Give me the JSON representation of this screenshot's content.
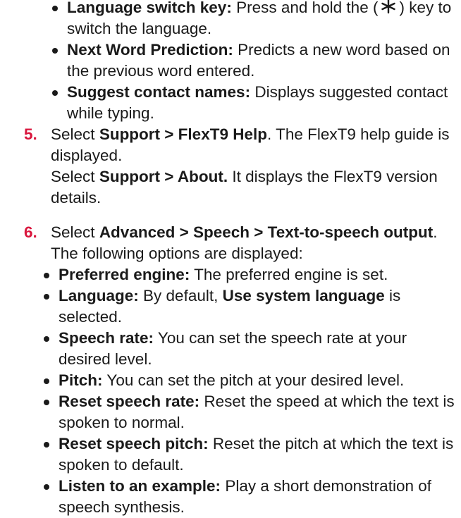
{
  "step4": {
    "lead_partial": "",
    "bullets": [
      {
        "term": "Language switch key:",
        "text_a": "Press and hold the (",
        "text_b": ") key to switch the language."
      },
      {
        "term": "Next Word Prediction:",
        "text": "Predicts a new word based on the previous word entered."
      },
      {
        "term": "Suggest contact names:",
        "text": "Displays suggested contact while typing."
      }
    ]
  },
  "step5": {
    "number": "5.",
    "pre1": "Select",
    "menu1": "Support > FlexT9 Help",
    "post1": ". The FlexT9 help guide is displayed.",
    "pre2": "Select",
    "menu2": "Support > About.",
    "post2": "It displays the FlexT9 version details."
  },
  "step6": {
    "number": "6.",
    "pre": "Select",
    "menu": "Advanced > Speech > Text-to-speech output",
    "post": ". The following options are displayed:",
    "bullets": [
      {
        "term": "Preferred engine:",
        "text": "The preferred engine is set."
      },
      {
        "term": "Language:",
        "text_a": "By default,",
        "bold_mid": "Use system language",
        "text_b": "is selected."
      },
      {
        "term": "Speech rate:",
        "text": "You can set the speech rate at your desired level."
      },
      {
        "term": "Pitch:",
        "text": "You can set the pitch at your desired level."
      },
      {
        "term": "Reset speech rate:",
        "text": "Reset the speed at which the text is spoken to normal."
      },
      {
        "term": "Reset speech pitch:",
        "text": "Reset the pitch at which the text is spoken to default."
      },
      {
        "term": "Listen to an example:",
        "text": "Play a short demonstration of speech synthesis."
      }
    ]
  },
  "icons": {
    "language_key": "asterisk-key-icon"
  },
  "colors": {
    "step_number": "#d9163d",
    "text": "#1a1a1a"
  }
}
